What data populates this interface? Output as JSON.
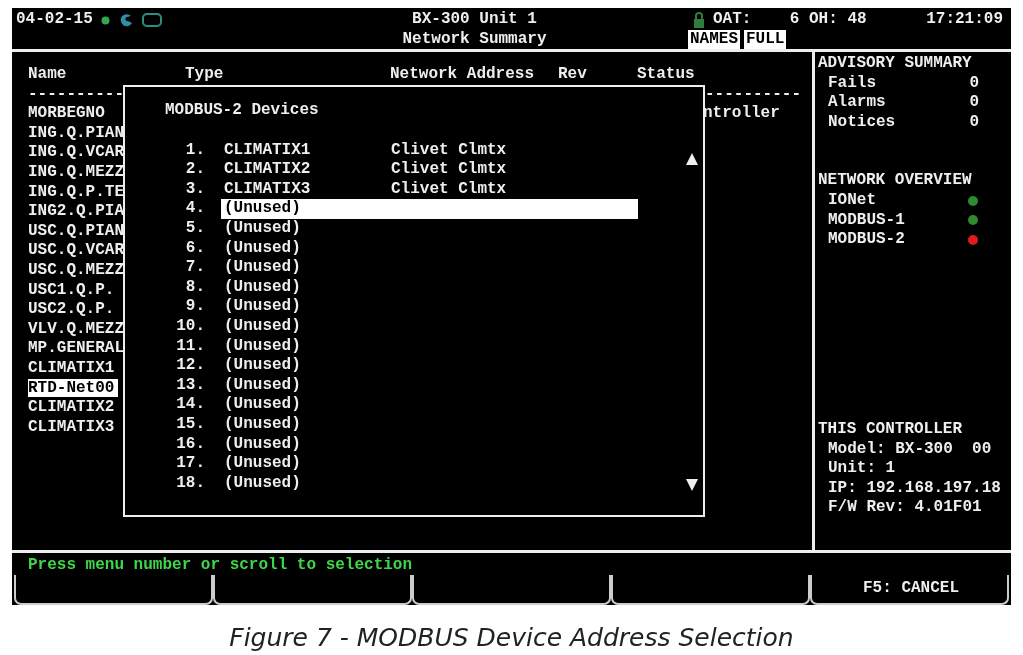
{
  "header": {
    "date": "04-02-15",
    "title": "BX-300 Unit 1",
    "subtitle": "Network Summary",
    "oat": "OAT:    6 OH: 48",
    "time": "17:21:09",
    "view_buttons": [
      {
        "label": "NAMES"
      },
      {
        "label": "FULL"
      }
    ]
  },
  "network_table": {
    "columns": [
      "Name",
      "Type",
      "Network Address",
      "Rev",
      "Status"
    ],
    "separator_left": "----------",
    "separator_right": "----------",
    "status_fragment": "ntroller",
    "rows": [
      {
        "name": "MORBEGNO",
        "selected": false
      },
      {
        "name": "ING.Q.PIAN",
        "selected": false
      },
      {
        "name": "ING.Q.VCAR",
        "selected": false
      },
      {
        "name": "ING.Q.MEZZ",
        "selected": false
      },
      {
        "name": "ING.Q.P.TE",
        "selected": false
      },
      {
        "name": "ING2.Q.PIA",
        "selected": false
      },
      {
        "name": "USC.Q.PIAN",
        "selected": false
      },
      {
        "name": "USC.Q.VCAR",
        "selected": false
      },
      {
        "name": "USC.Q.MEZZ",
        "selected": false
      },
      {
        "name": "USC1.Q.P.",
        "selected": false
      },
      {
        "name": "USC2.Q.P.",
        "selected": false
      },
      {
        "name": "VLV.Q.MEZZ",
        "selected": false
      },
      {
        "name": "MP.GENERAL",
        "selected": false
      },
      {
        "name": "CLIMATIX1",
        "selected": false
      },
      {
        "name": "RTD-Net00",
        "selected": true
      },
      {
        "name": "CLIMATIX2",
        "selected": false
      },
      {
        "name": "CLIMATIX3",
        "selected": false
      }
    ]
  },
  "dialog": {
    "title": "MODBUS-2 Devices",
    "items": [
      {
        "number": "1.",
        "name": "CLIMATIX1",
        "type": "Clivet Clmtx",
        "selected": false
      },
      {
        "number": "2.",
        "name": "CLIMATIX2",
        "type": "Clivet Clmtx",
        "selected": false
      },
      {
        "number": "3.",
        "name": "CLIMATIX3",
        "type": "Clivet Clmtx",
        "selected": false
      },
      {
        "number": "4.",
        "name": "(Unused)",
        "selected": true
      },
      {
        "number": "5.",
        "name": "(Unused)",
        "selected": false
      },
      {
        "number": "6.",
        "name": "(Unused)",
        "selected": false
      },
      {
        "number": "7.",
        "name": "(Unused)",
        "selected": false
      },
      {
        "number": "8.",
        "name": "(Unused)",
        "selected": false
      },
      {
        "number": "9.",
        "name": "(Unused)",
        "selected": false
      },
      {
        "number": "10.",
        "name": "(Unused)",
        "selected": false
      },
      {
        "number": "11.",
        "name": "(Unused)",
        "selected": false
      },
      {
        "number": "12.",
        "name": "(Unused)",
        "selected": false
      },
      {
        "number": "13.",
        "name": "(Unused)",
        "selected": false
      },
      {
        "number": "14.",
        "name": "(Unused)",
        "selected": false
      },
      {
        "number": "15.",
        "name": "(Unused)",
        "selected": false
      },
      {
        "number": "16.",
        "name": "(Unused)",
        "selected": false
      },
      {
        "number": "17.",
        "name": "(Unused)",
        "selected": false
      },
      {
        "number": "18.",
        "name": "(Unused)",
        "selected": false
      }
    ]
  },
  "advisory_summary": {
    "heading": "ADVISORY SUMMARY",
    "items": [
      {
        "label": "Fails",
        "value": "0"
      },
      {
        "label": "Alarms",
        "value": "0"
      },
      {
        "label": "Notices",
        "value": "0"
      }
    ]
  },
  "network_overview": {
    "heading": "NETWORK OVERVIEW",
    "items": [
      {
        "label": "IONet",
        "color": "#2e8b2e"
      },
      {
        "label": "MODBUS-1",
        "color": "#2e8b2e"
      },
      {
        "label": "MODBUS-2",
        "color": "#e01b1b"
      }
    ]
  },
  "this_controller": {
    "heading": "THIS CONTROLLER",
    "lines": [
      "Model: BX-300  00",
      "Unit: 1",
      "IP: 192.168.197.18",
      "F/W Rev: 4.01F01"
    ]
  },
  "status_line": "Press menu number or scroll to selection",
  "softkeys": [
    {
      "kind": "blank"
    },
    {
      "kind": "blank"
    },
    {
      "kind": "blank"
    },
    {
      "kind": "blank"
    },
    {
      "kind": "labeled",
      "label": "F5: CANCEL"
    }
  ],
  "caption": "Figure 7 - MODBUS Device Address Selection"
}
